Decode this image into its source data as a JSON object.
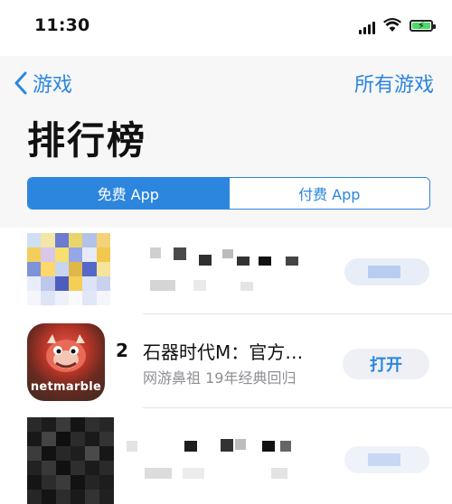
{
  "status_bar": {
    "time": "11:30"
  },
  "nav": {
    "back_label": "游戏",
    "right_label": "所有游戏"
  },
  "page_title": "排行榜",
  "segments": [
    {
      "label": "免费 App",
      "active": true
    },
    {
      "label": "付费 App",
      "active": false
    }
  ],
  "apps": [
    {
      "rank": "",
      "name": "",
      "subtitle": "",
      "button": ""
    },
    {
      "rank": "2",
      "name": "石器时代M：官方…",
      "subtitle": "网游鼻祖 19年经典回归",
      "button": "打开",
      "icon_brand": "netmarble"
    },
    {
      "rank": "",
      "name": "",
      "subtitle": "",
      "button": ""
    }
  ],
  "colors": {
    "accent": "#2c86de",
    "header_bg": "#f7f7f8",
    "button_bg": "#eef0f5",
    "muted": "#8e8e93"
  },
  "icons": [
    "signal-icon",
    "wifi-icon",
    "battery-icon",
    "chevron-left-icon"
  ]
}
